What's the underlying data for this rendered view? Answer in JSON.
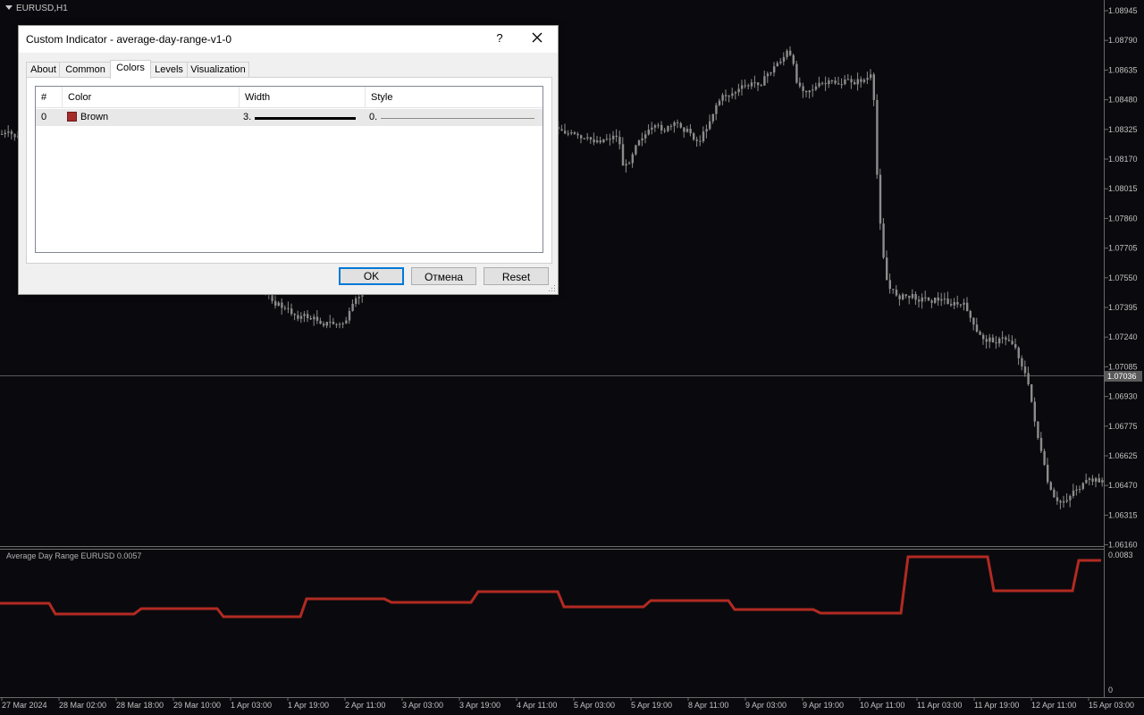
{
  "chart": {
    "symbol": "EURUSD,H1",
    "price_axis": [
      "1.08945",
      "1.08790",
      "1.08635",
      "1.08480",
      "1.08325",
      "1.08170",
      "1.08015",
      "1.07860",
      "1.07705",
      "1.07550",
      "1.07395",
      "1.07240",
      "1.07085",
      "1.06930",
      "1.06775",
      "1.06625",
      "1.06470",
      "1.06315",
      "1.06160"
    ],
    "current_price": "1.07036",
    "time_axis": [
      "27 Mar 2024",
      "28 Mar 02:00",
      "28 Mar 18:00",
      "29 Mar 10:00",
      "1 Apr 03:00",
      "1 Apr 19:00",
      "2 Apr 11:00",
      "3 Apr 03:00",
      "3 Apr 19:00",
      "4 Apr 11:00",
      "5 Apr 03:00",
      "5 Apr 19:00",
      "8 Apr 11:00",
      "9 Apr 03:00",
      "9 Apr 19:00",
      "10 Apr 11:00",
      "11 Apr 03:00",
      "11 Apr 19:00",
      "12 Apr 11:00",
      "15 Apr 03:00"
    ],
    "indicator_label": "Average Day Range EURUSD  0.0057",
    "indicator_axis": [
      "0.0083",
      "0"
    ],
    "colors": {
      "background": "#0a0a0e",
      "candle": "#8c8c8c",
      "indicator_line": "#b22a22",
      "grid": "#6a6a6a",
      "axis_text": "#c0c0c0"
    }
  },
  "dialog": {
    "title": "Custom Indicator - average-day-range-v1-0",
    "help_label": "?",
    "tabs": [
      "About",
      "Common",
      "Colors",
      "Levels",
      "Visualization"
    ],
    "active_tab": "Colors",
    "table": {
      "headers": [
        "#",
        "Color",
        "Width",
        "Style"
      ],
      "rows": [
        {
          "index": "0",
          "color_name": "Brown",
          "color_hex": "#a52a2a",
          "width": "3.",
          "style": "0."
        }
      ]
    },
    "buttons": {
      "ok": "OK",
      "cancel": "Отмена",
      "reset": "Reset"
    }
  }
}
